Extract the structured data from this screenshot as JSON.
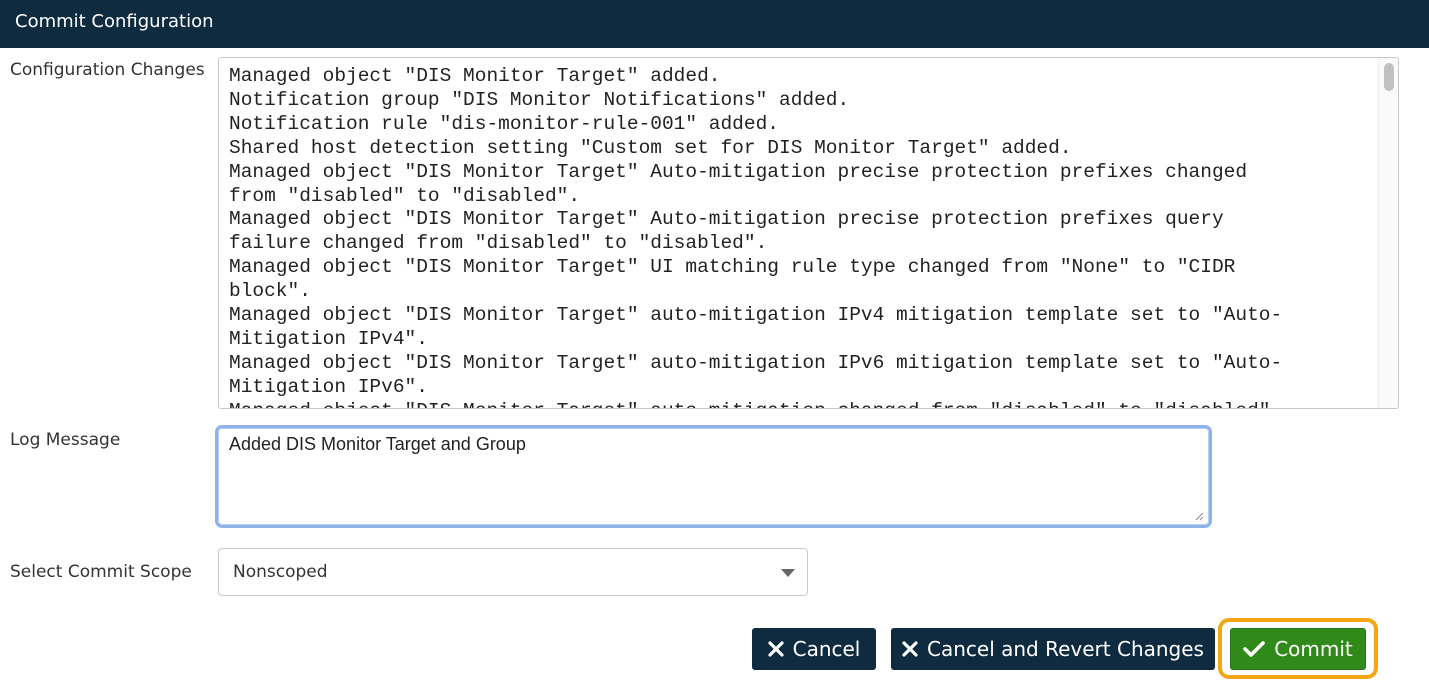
{
  "dialog": {
    "title": "Commit Configuration"
  },
  "labels": {
    "configuration_changes": "Configuration Changes",
    "log_message": "Log Message",
    "select_commit_scope": "Select Commit Scope"
  },
  "changes": {
    "text": "Managed object \"DIS Monitor Target\" added.\nNotification group \"DIS Monitor Notifications\" added.\nNotification rule \"dis-monitor-rule-001\" added.\nShared host detection setting \"Custom set for DIS Monitor Target\" added.\nManaged object \"DIS Monitor Target\" Auto-mitigation precise protection prefixes changed\nfrom \"disabled\" to \"disabled\".\nManaged object \"DIS Monitor Target\" Auto-mitigation precise protection prefixes query\nfailure changed from \"disabled\" to \"disabled\".\nManaged object \"DIS Monitor Target\" UI matching rule type changed from \"None\" to \"CIDR\nblock\".\nManaged object \"DIS Monitor Target\" auto-mitigation IPv4 mitigation template set to \"Auto-\nMitigation IPv4\".\nManaged object \"DIS Monitor Target\" auto-mitigation IPv6 mitigation template set to \"Auto-\nMitigation IPv6\".\nManaged object \"DIS Monitor Target\" auto-mitigation changed from \"disabled\" to \"disabled\"."
  },
  "log_message": {
    "value": "Added DIS Monitor Target and Group"
  },
  "commit_scope": {
    "selected": "Nonscoped"
  },
  "buttons": {
    "cancel": "Cancel",
    "cancel_revert": "Cancel and Revert Changes",
    "commit": "Commit"
  },
  "colors": {
    "titlebar": "#0f2b40",
    "commit_button": "#2f8a1a",
    "highlight_ring": "#f5a614",
    "focus_border": "#8fb3e8"
  },
  "icons": {
    "cancel": "close-icon",
    "cancel_revert": "close-icon",
    "commit": "checkmark-icon",
    "select": "chevron-down-icon"
  }
}
